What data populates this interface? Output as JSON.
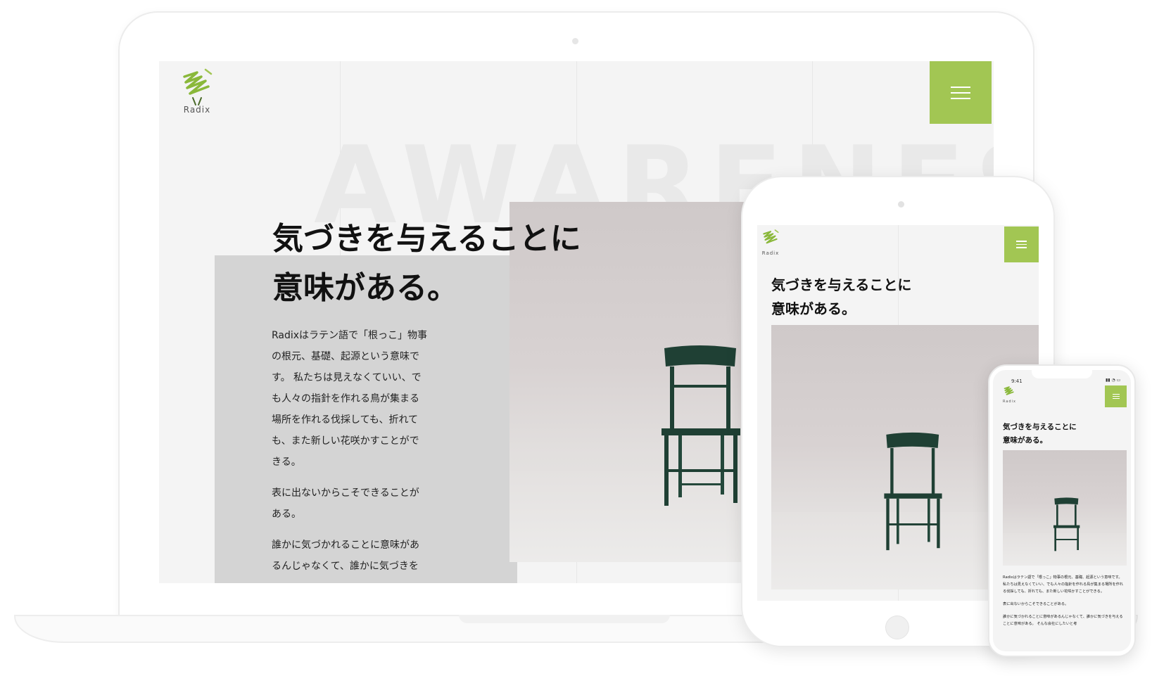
{
  "brand": {
    "logo_text": "Radix",
    "accent_color": "#a2c653",
    "logo_icon": "radix-leaf-logo-icon"
  },
  "hero": {
    "background_word": "AWARENESS",
    "title_line1": "気づきを与えることに",
    "title_line2": "意味がある。",
    "image": "green-wooden-chair-photo"
  },
  "body": {
    "paragraph1_lines": [
      "Radixはラテン語で「根っこ」物事",
      "の根元、基礎、起源という意味で",
      "す。 私たちは見えなくていい、で",
      "も人々の指針を作れる鳥が集まる",
      "場所を作れる伐採しても、折れて",
      "も、また新しい花咲かすことがで",
      "きる。"
    ],
    "paragraph2_lines": [
      "表に出ないからこそできることが",
      "ある。"
    ],
    "paragraph3_lines": [
      "誰かに気づかれることに意味があ",
      "るんじゃなくて、誰かに気づきを"
    ]
  },
  "phone": {
    "status_time": "9:41",
    "text_block1": "Radixはラテン語で「根っこ」物事の根元、基礎、起源という意味です。 私たちは見えなくていい、でも人々の指針を作れる鳥が集まる場所を作れる伐採しても、折れても、また新しい花咲かすことができる。",
    "text_block2": "表に出ないからこそできることがある。",
    "text_block3": "誰かに気づかれることに意味があるんじゃなくて、誰かに気づきを与えることに意味がある。 そんな会社にしたいと考"
  },
  "icons": {
    "menu": "hamburger-menu-icon"
  }
}
